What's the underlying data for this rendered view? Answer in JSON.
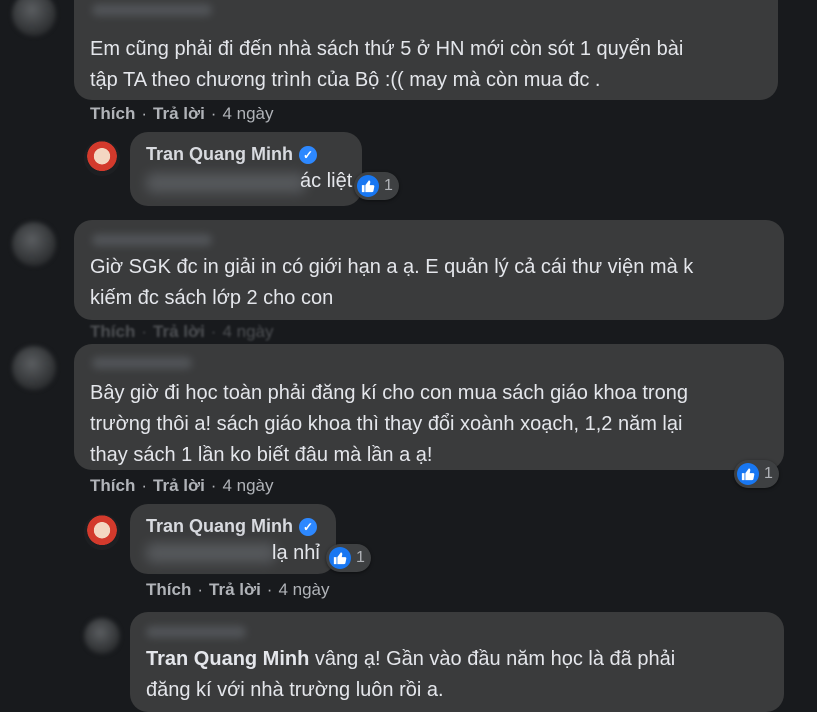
{
  "comments": [
    {
      "text": "Em cũng phải đi đến nhà sách thứ 5 ở HN mới còn sót 1 quyển bài tập TA theo chương trình của Bộ :(( may mà còn mua đc .",
      "line1": "Em cũng phải đi đến nhà sách thứ 5 ở HN mới còn sót 1 quyển bài",
      "line2": "tập TA theo chương trình của Bộ :(( may mà còn mua đc .",
      "actions": {
        "like": "Thích",
        "reply": "Trả lời",
        "time": "4 ngày"
      }
    },
    {
      "author": "Tran Quang Minh",
      "visible_text": "ác liệt",
      "reaction_count": "1"
    },
    {
      "line1": "Giờ SGK đc in giải in có giới hạn a ạ. E quản lý cả cái thư viện mà k",
      "line2": "kiếm đc sách lớp 2 cho con",
      "actions": {
        "like": "Thích",
        "reply": "Trả lời",
        "time": "4 ngày"
      }
    },
    {
      "line1": "Bây giờ đi học toàn phải đăng kí cho con mua sách giáo khoa trong",
      "line2": "trường thôi a! sách giáo khoa thì thay đổi xoành xoạch, 1,2 năm lại",
      "line3": "thay sách 1 lần ko biết đâu mà lần a ạ!",
      "reaction_count": "1",
      "actions": {
        "like": "Thích",
        "reply": "Trả lời",
        "time": "4 ngày"
      }
    },
    {
      "author": "Tran Quang Minh",
      "visible_text": "lạ nhỉ",
      "reaction_count": "1",
      "actions": {
        "like": "Thích",
        "reply": "Trả lời",
        "time": "4 ngày"
      }
    },
    {
      "mention": "Tran Quang Minh",
      "line1_rest": " vâng ạ! Gần vào đầu năm học là đã phải",
      "line2": "đăng kí với nhà trường luôn rồi a."
    }
  ],
  "icons": {
    "verified": "verified-badge-icon",
    "like": "like-thumb-icon"
  },
  "colors": {
    "background": "#181a1d",
    "bubble": "#3a3b3c",
    "like_blue": "#1877f2"
  }
}
